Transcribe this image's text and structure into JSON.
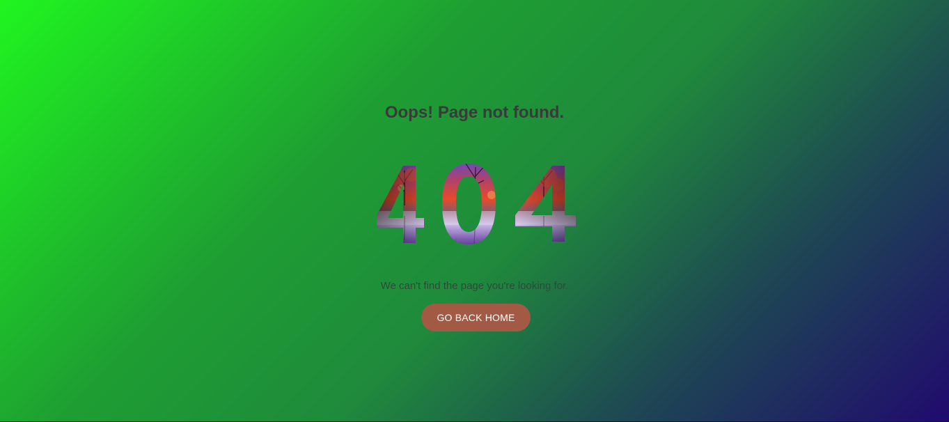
{
  "error": {
    "heading": "Oops! Page not found.",
    "code": "404",
    "code_digits": [
      "4",
      "0",
      "4"
    ],
    "message": "We can't find the page you're looking for.",
    "home_button_label": "GO BACK HOME"
  },
  "colors": {
    "gradient_start": "#1ff51f",
    "gradient_end": "#200a6e",
    "heading_text": "#3a3a3a",
    "button_background": "#a35a44",
    "button_text": "#ffffff"
  }
}
